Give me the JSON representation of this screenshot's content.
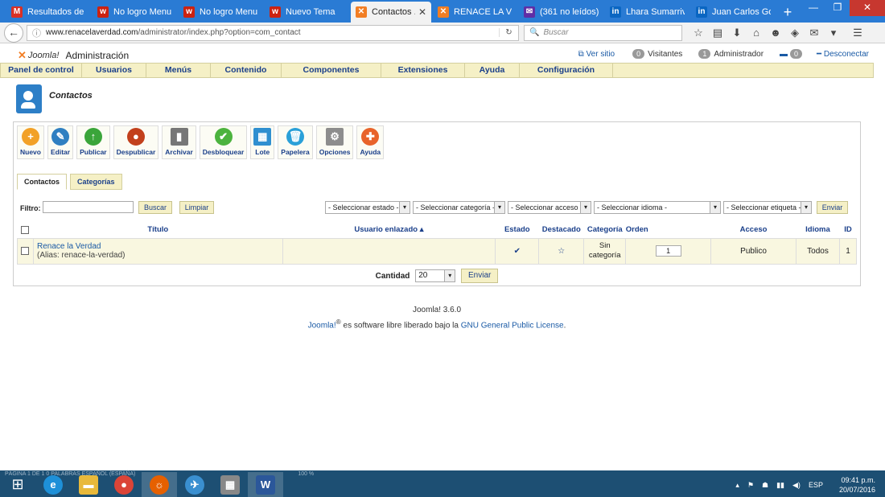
{
  "browser": {
    "tabs": [
      {
        "label": "Resultados de l...",
        "icon": "gmail-icon",
        "icon_char": "M",
        "color": "#d93025"
      },
      {
        "label": "No logro Menu...",
        "icon": "webnode-icon",
        "icon_char": "w",
        "color": "#cc2211"
      },
      {
        "label": "No logro Menu...",
        "icon": "webnode-icon",
        "icon_char": "w",
        "color": "#cc2211"
      },
      {
        "label": "Nuevo Tema",
        "icon": "webnode-icon",
        "icon_char": "w",
        "color": "#cc2211"
      },
      {
        "label": "Contactos ...",
        "icon": "joomla-icon",
        "icon_char": "✕",
        "color": "#f27e24",
        "active": true
      },
      {
        "label": "RENACE LA VE...",
        "icon": "joomla-icon",
        "icon_char": "✕",
        "color": "#f27e24"
      },
      {
        "label": "(361 no leídos) ...",
        "icon": "yahoo-mail-icon",
        "icon_char": "✉",
        "color": "#5f2ea6"
      },
      {
        "label": "Lhara Sumarriv...",
        "icon": "linkedin-icon",
        "icon_char": "in",
        "color": "#0a66c2"
      },
      {
        "label": "Juan Carlos Go...",
        "icon": "linkedin-icon",
        "icon_char": "in",
        "color": "#0a66c2"
      }
    ],
    "url_host": "www.renacelaverdad.com",
    "url_path": "/administrator/index.php?option=com_contact",
    "search_placeholder": "Buscar"
  },
  "header": {
    "app_title": "Administración",
    "logo_text": "Joomla!",
    "view_site": "Ver sitio",
    "visitors_count": "0",
    "visitors_label": "Visitantes",
    "admin_count": "1",
    "admin_label": "Administrador",
    "messages_count": "0",
    "logout": "Desconectar"
  },
  "menu": [
    {
      "label": "Panel de control"
    },
    {
      "label": "Usuarios"
    },
    {
      "label": "Menús"
    },
    {
      "label": "Contenido"
    },
    {
      "label": "Componentes"
    },
    {
      "label": "Extensiones"
    },
    {
      "label": "Ayuda"
    },
    {
      "label": "Configuración"
    }
  ],
  "page_title": "Contactos",
  "toolbar": [
    {
      "label": "Nuevo",
      "icon": "plus-icon",
      "glyph": "+",
      "color": "#f2a127"
    },
    {
      "label": "Editar",
      "icon": "pencil-icon",
      "glyph": "✎",
      "color": "#2f7fc1"
    },
    {
      "label": "Publicar",
      "icon": "arrow-up-icon",
      "glyph": "↑",
      "color": "#3aa53a"
    },
    {
      "label": "Despublicar",
      "icon": "unpublish-icon",
      "glyph": "●",
      "color": "#c2401c"
    },
    {
      "label": "Archivar",
      "icon": "archive-icon",
      "glyph": "▮",
      "color": "#777777"
    },
    {
      "label": "Desbloquear",
      "icon": "checkmark-icon",
      "glyph": "✔",
      "color": "#4cb33e"
    },
    {
      "label": "Lote",
      "icon": "batch-icon",
      "glyph": "▦",
      "color": "#2f8fd0"
    },
    {
      "label": "Papelera",
      "icon": "trash-icon",
      "glyph": "🗑",
      "color": "#2aa0d8"
    },
    {
      "label": "Opciones",
      "icon": "options-icon",
      "glyph": "⚙",
      "color": "#8d8d8d"
    },
    {
      "label": "Ayuda",
      "icon": "lifebuoy-icon",
      "glyph": "✚",
      "color": "#e8632a"
    }
  ],
  "subtabs": [
    {
      "label": "Contactos",
      "active": true
    },
    {
      "label": "Categorías"
    }
  ],
  "filters": {
    "filter_label": "Filtro:",
    "filter_value": "",
    "search_button": "Buscar",
    "clear_button": "Limpiar",
    "state": "- Seleccionar estado -",
    "category": "- Seleccionar categoría -",
    "access": "- Seleccionar acceso -",
    "language": "- Seleccionar idioma -",
    "tag": "- Seleccionar etiqueta -",
    "submit": "Enviar"
  },
  "table": {
    "columns": {
      "title": "Título",
      "linked_user": "Usuario enlazado ▴",
      "status": "Estado",
      "featured": "Destacado",
      "category": "Categoría",
      "order": "Orden",
      "access": "Acceso",
      "language": "Idioma",
      "id": "ID"
    },
    "rows": [
      {
        "title": "Renace la Verdad",
        "alias": "(Alias: renace-la-verdad)",
        "linked_user": "",
        "status": "✔",
        "featured": "☆",
        "category": "Sin categoría",
        "order": "1",
        "access": "Publico",
        "language": "Todos",
        "id": "1"
      }
    ]
  },
  "pager": {
    "label": "Cantidad",
    "value": "20",
    "submit": "Enviar"
  },
  "footer": {
    "version": "Joomla! 3.6.0",
    "brand": "Joomla!",
    "reg": "®",
    "text": " es software libre liberado bajo la ",
    "license": "GNU General Public License",
    "end": "."
  },
  "taskbar": {
    "word_status": "PÁGINA 1 DE 1    0 PALABRAS    ESPAÑOL (ESPAÑA)",
    "zoom": "100 %",
    "language": "ESP",
    "time": "09:41 p.m.",
    "date": "20/07/2016"
  }
}
